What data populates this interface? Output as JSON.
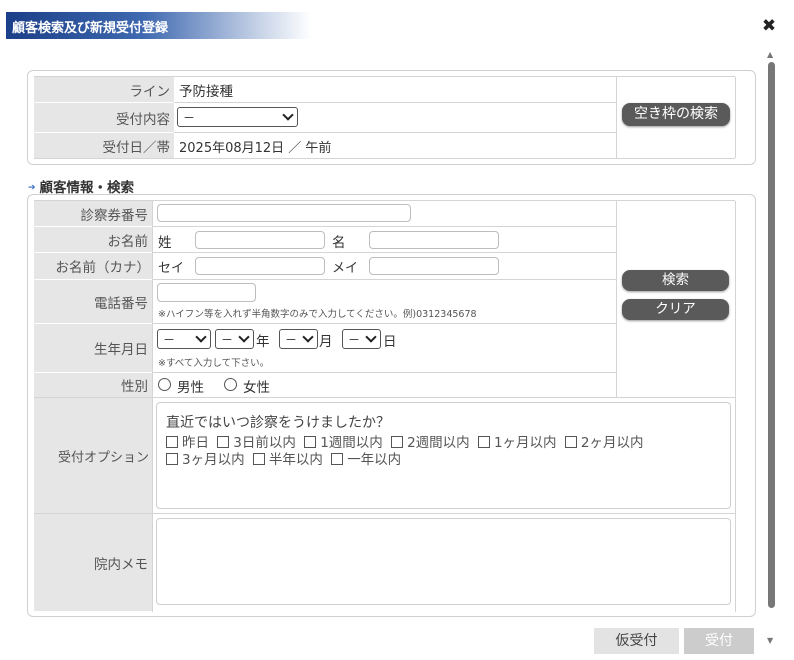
{
  "dialog": {
    "title": "顧客検索及び新規受付登録"
  },
  "reception": {
    "line_label": "ライン",
    "line_value": "予防接種",
    "content_label": "受付内容",
    "content_value": "－",
    "date_label": "受付日／帯",
    "date_value": "2025年08月12日 ／ 午前",
    "search_slots_button": "空き枠の検索"
  },
  "customer": {
    "section_title": "顧客情報・検索",
    "card_number_label": "診察券番号",
    "name_label": "お名前",
    "last_name_label": "姓",
    "first_name_label": "名",
    "kana_label": "お名前（カナ）",
    "kana_last_label": "セイ",
    "kana_first_label": "メイ",
    "phone_label": "電話番号",
    "phone_note": "※ハイフン等を入れず半角数字のみで入力してください。例)0312345678",
    "birth_label": "生年月日",
    "birth_year": "－",
    "birth_month": "－",
    "birth_day": "－",
    "year_unit": "年",
    "month_unit": "月",
    "day_unit": "日",
    "birth_note": "※すべて入力して下さい。",
    "gender_label": "性別",
    "gender_male": "男性",
    "gender_female": "女性",
    "search_button": "検索",
    "clear_button": "クリア",
    "option_label": "受付オプション",
    "option_question": "直近ではいつ診察をうけましたか？",
    "option_items": [
      "昨日",
      "3日前以内",
      "1週間以内",
      "2週間以内",
      "1ヶ月以内",
      "2ヶ月以内",
      "3ヶ月以内",
      "半年以内",
      "一年以内"
    ],
    "memo_label": "院内メモ"
  },
  "footer": {
    "provisional_button": "仮受付",
    "accept_button": "受付"
  },
  "colors": {
    "title_bar": "#1b3f88",
    "label_bg": "#e6e6e6",
    "dark_button": "#5a5a5a",
    "disabled_button": "#cccccc"
  }
}
